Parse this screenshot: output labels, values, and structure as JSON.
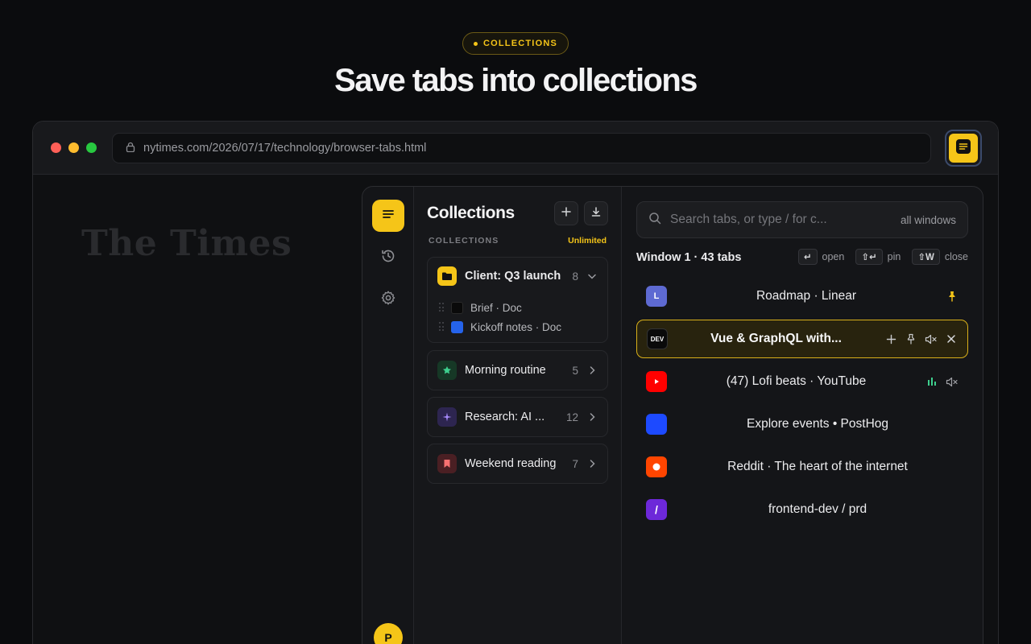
{
  "hero": {
    "badge": "COLLECTIONS",
    "title": "Save tabs into collections"
  },
  "browser": {
    "url": "nytimes.com/2026/07/17/technology/browser-tabs.html",
    "page_logo": "The Times"
  },
  "rail": {
    "avatar_initial": "P",
    "icons": [
      "list-icon",
      "history-icon",
      "gear-icon"
    ]
  },
  "collections": {
    "title": "Collections",
    "section_label": "COLLECTIONS",
    "plan": "Unlimited",
    "items": [
      {
        "name": "Client: Q3 launch",
        "count": "8",
        "expanded": true,
        "icon": "folder-icon",
        "icon_color": "#f5c518",
        "children": [
          {
            "title": "Brief · Doc",
            "favicon_color": "#0a0a0a"
          },
          {
            "title": "Kickoff notes · Doc",
            "favicon_color": "#2563eb"
          }
        ]
      },
      {
        "name": "Morning routine",
        "count": "5",
        "expanded": false,
        "icon": "star-icon",
        "icon_color": "#3ecf8e"
      },
      {
        "name": "Research: AI ...",
        "count": "12",
        "expanded": false,
        "icon": "sparkle-icon",
        "icon_color": "#a78bfa"
      },
      {
        "name": "Weekend reading",
        "count": "7",
        "expanded": false,
        "icon": "bookmark-icon",
        "icon_color": "#f87171"
      }
    ]
  },
  "tabs": {
    "search_placeholder": "Search tabs, or type / for c...",
    "search_scope": "all windows",
    "window_label": "Window 1 · 43 tabs",
    "shortcuts": [
      {
        "key": "↵",
        "label": "open"
      },
      {
        "key": "⇧↵",
        "label": "pin"
      },
      {
        "key": "⇧W",
        "label": "close"
      }
    ],
    "list": [
      {
        "title": "Roadmap · Linear",
        "favicon_text": "L",
        "favicon_color": "#5e6ad2",
        "pinned": true
      },
      {
        "title": "Vue & GraphQL with...",
        "favicon_text": "DEV",
        "favicon_color": "#0a0a0a",
        "active": true
      },
      {
        "title": "(47) Lofi beats · YouTube",
        "favicon_text": "",
        "favicon_color": "#ff0000",
        "playing_audio": true
      },
      {
        "title": "Explore events • PostHog",
        "favicon_text": "",
        "favicon_color": "#1d4aff"
      },
      {
        "title": "Reddit · The heart of the internet",
        "favicon_text": "",
        "favicon_color": "#ff4500"
      },
      {
        "title": "frontend-dev / prd",
        "favicon_text": "/",
        "favicon_color": "#6d28d9"
      }
    ]
  },
  "colors": {
    "accent": "#f5c518",
    "background": "#0b0c0e",
    "panel": "#141518",
    "audio_green": "#3ecf8e"
  }
}
